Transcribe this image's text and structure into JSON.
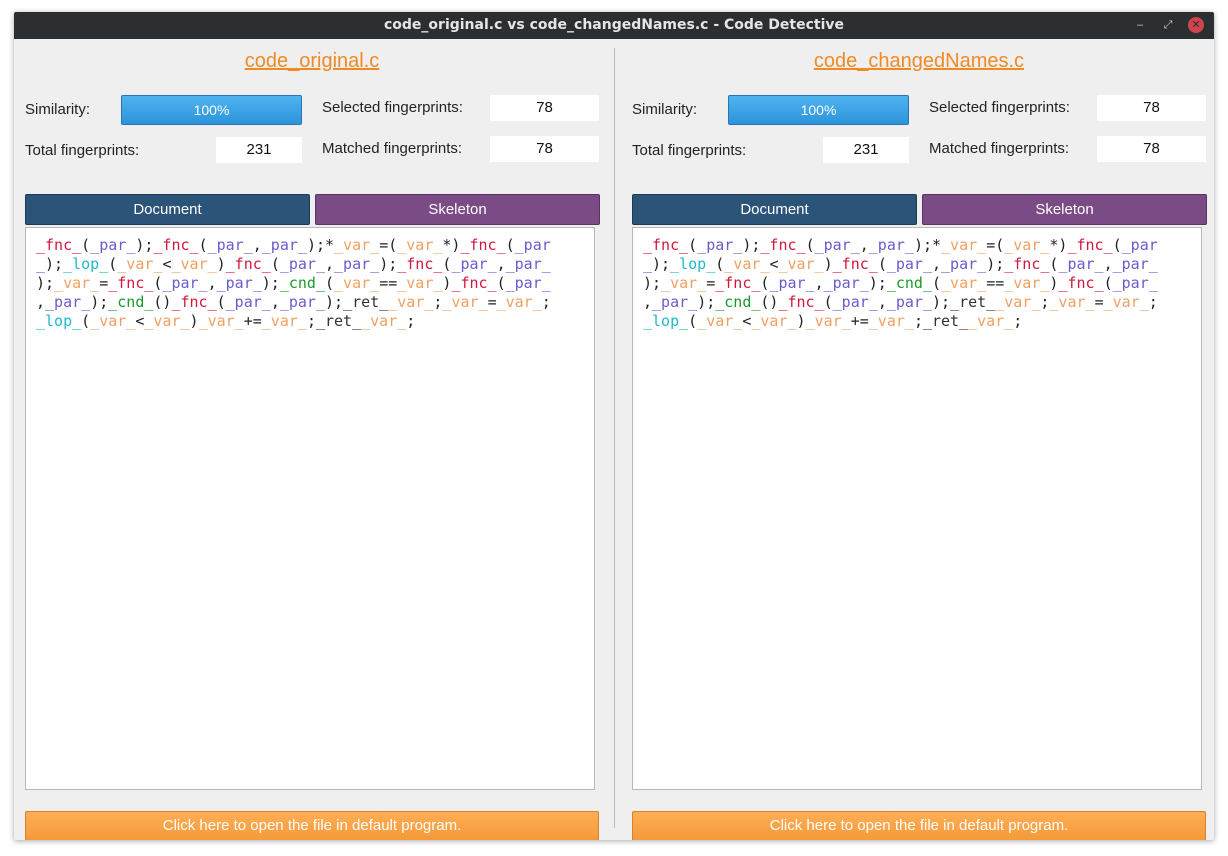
{
  "window": {
    "title": "code_original.c vs code_changedNames.c - Code Detective",
    "minimize_glyph": "–",
    "maximize_glyph": "⤢",
    "close_glyph": "✕"
  },
  "colors": {
    "accent_orange": "#f08a24",
    "similarity_blue": "#2d94dc",
    "document_tab": "#2b5478",
    "skeleton_tab": "#7b4b86"
  },
  "panels": [
    {
      "filename": "code_original.c",
      "similarity_label": "Similarity:",
      "similarity_value": "100%",
      "similarity_fraction": 1.0,
      "selected_label": "Selected fingerprints:",
      "selected_value": "78",
      "total_label": "Total fingerprints:",
      "total_value": "231",
      "matched_label": "Matched fingerprints:",
      "matched_value": "78",
      "tab_document": "Document",
      "tab_skeleton": "Skeleton",
      "open_button": "Click here to open the file in default program."
    },
    {
      "filename": "code_changedNames.c",
      "similarity_label": "Similarity:",
      "similarity_value": "100%",
      "similarity_fraction": 1.0,
      "selected_label": "Selected fingerprints:",
      "selected_value": "78",
      "total_label": "Total fingerprints:",
      "total_value": "231",
      "matched_label": "Matched fingerprints:",
      "matched_value": "78",
      "tab_document": "Document",
      "tab_skeleton": "Skeleton",
      "open_button": "Click here to open the file in default program."
    }
  ],
  "code_lines": [
    [
      {
        "t": "_fnc_",
        "k": "fnc"
      },
      {
        "t": "(",
        "k": "pun"
      },
      {
        "t": "_par_",
        "k": "par"
      },
      {
        "t": ");",
        "k": "pun"
      },
      {
        "t": "_fnc_",
        "k": "fnc"
      },
      {
        "t": "(",
        "k": "pun"
      },
      {
        "t": "_par_",
        "k": "par"
      },
      {
        "t": ",",
        "k": "pun"
      },
      {
        "t": "_par_",
        "k": "par"
      },
      {
        "t": ");*",
        "k": "pun"
      },
      {
        "t": "_var_",
        "k": "var"
      },
      {
        "t": "=(",
        "k": "pun"
      },
      {
        "t": "_var_",
        "k": "var"
      },
      {
        "t": "*)",
        "k": "pun"
      },
      {
        "t": "_fnc_",
        "k": "fnc"
      },
      {
        "t": "(",
        "k": "pun"
      },
      {
        "t": "_par",
        "k": "par"
      }
    ],
    [
      {
        "t": "_",
        "k": "par"
      },
      {
        "t": ");",
        "k": "pun"
      },
      {
        "t": "_lop_",
        "k": "lop"
      },
      {
        "t": "(",
        "k": "pun"
      },
      {
        "t": "_var_",
        "k": "var"
      },
      {
        "t": "<",
        "k": "pun"
      },
      {
        "t": "_var_",
        "k": "var"
      },
      {
        "t": ")",
        "k": "pun"
      },
      {
        "t": "_fnc_",
        "k": "fnc"
      },
      {
        "t": "(",
        "k": "pun"
      },
      {
        "t": "_par_",
        "k": "par"
      },
      {
        "t": ",",
        "k": "pun"
      },
      {
        "t": "_par_",
        "k": "par"
      },
      {
        "t": ");",
        "k": "pun"
      },
      {
        "t": "_fnc_",
        "k": "fnc"
      },
      {
        "t": "(",
        "k": "pun"
      },
      {
        "t": "_par_",
        "k": "par"
      },
      {
        "t": ",",
        "k": "pun"
      },
      {
        "t": "_par_",
        "k": "par"
      }
    ],
    [
      {
        "t": ");",
        "k": "pun"
      },
      {
        "t": "_var_",
        "k": "var"
      },
      {
        "t": "=",
        "k": "pun"
      },
      {
        "t": "_fnc_",
        "k": "fnc"
      },
      {
        "t": "(",
        "k": "pun"
      },
      {
        "t": "_par_",
        "k": "par"
      },
      {
        "t": ",",
        "k": "pun"
      },
      {
        "t": "_par_",
        "k": "par"
      },
      {
        "t": ");",
        "k": "pun"
      },
      {
        "t": "_cnd_",
        "k": "cnd"
      },
      {
        "t": "(",
        "k": "pun"
      },
      {
        "t": "_var_",
        "k": "var"
      },
      {
        "t": "==",
        "k": "pun"
      },
      {
        "t": "_var_",
        "k": "var"
      },
      {
        "t": ")",
        "k": "pun"
      },
      {
        "t": "_fnc_",
        "k": "fnc"
      },
      {
        "t": "(",
        "k": "pun"
      },
      {
        "t": "_par_",
        "k": "par"
      }
    ],
    [
      {
        "t": ",",
        "k": "pun"
      },
      {
        "t": "_par_",
        "k": "par"
      },
      {
        "t": ");",
        "k": "pun"
      },
      {
        "t": "_cnd_",
        "k": "cnd"
      },
      {
        "t": "()",
        "k": "pun"
      },
      {
        "t": "_fnc_",
        "k": "fnc"
      },
      {
        "t": "(",
        "k": "pun"
      },
      {
        "t": "_par_",
        "k": "par"
      },
      {
        "t": ",",
        "k": "pun"
      },
      {
        "t": "_par_",
        "k": "par"
      },
      {
        "t": ");",
        "k": "pun"
      },
      {
        "t": "_ret_",
        "k": "ret"
      },
      {
        "t": "_var_",
        "k": "var"
      },
      {
        "t": ";",
        "k": "pun"
      },
      {
        "t": "_var_",
        "k": "var"
      },
      {
        "t": "=",
        "k": "pun"
      },
      {
        "t": "_var_",
        "k": "var"
      },
      {
        "t": ";",
        "k": "pun"
      }
    ],
    [
      {
        "t": "_lop_",
        "k": "lop"
      },
      {
        "t": "(",
        "k": "pun"
      },
      {
        "t": "_var_",
        "k": "var"
      },
      {
        "t": "<",
        "k": "pun"
      },
      {
        "t": "_var_",
        "k": "var"
      },
      {
        "t": ")",
        "k": "pun"
      },
      {
        "t": "_var_",
        "k": "var"
      },
      {
        "t": "+=",
        "k": "pun"
      },
      {
        "t": "_var_",
        "k": "var"
      },
      {
        "t": ";",
        "k": "pun"
      },
      {
        "t": "_ret_",
        "k": "ret"
      },
      {
        "t": "_var_",
        "k": "var"
      },
      {
        "t": ";",
        "k": "pun"
      }
    ]
  ]
}
